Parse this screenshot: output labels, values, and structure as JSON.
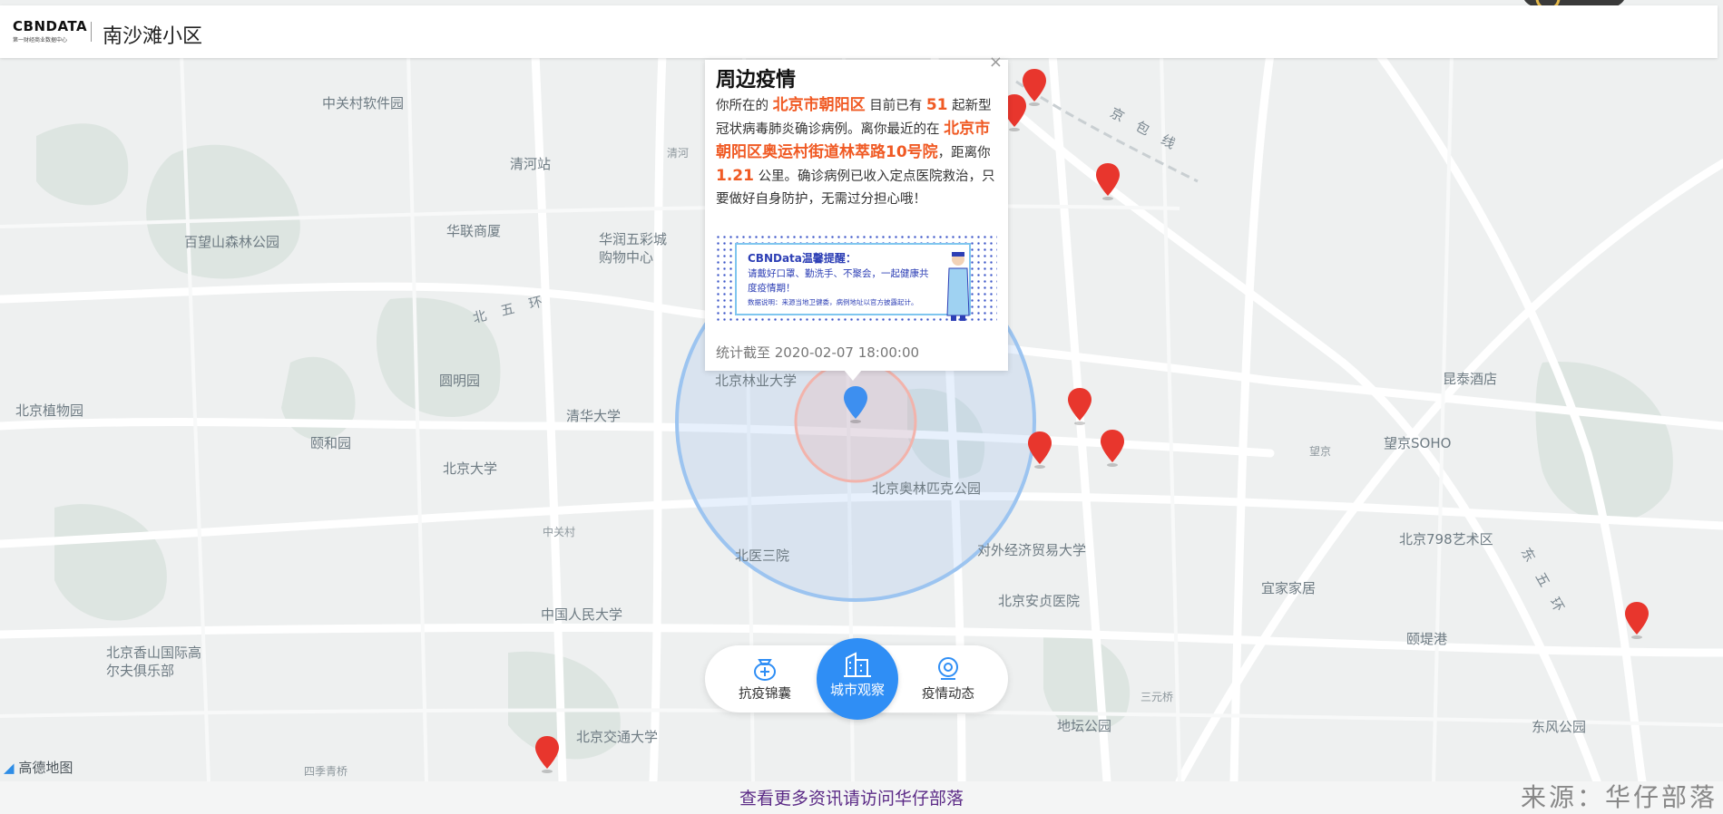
{
  "header": {
    "logo_text": "CBNDATA",
    "logo_sub": "第一财经商业数据中心",
    "title": "南沙滩小区"
  },
  "map": {
    "labels": [
      "中关村软件园",
      "清河站",
      "清河",
      "华联商厦",
      "华润五彩城购物中心",
      "百望山森林公园",
      "北京林业大学",
      "清华大学",
      "圆明园",
      "颐和园",
      "北京植物园",
      "北京大学",
      "北京奥林匹克公园",
      "对外经济贸易大学",
      "北医三院",
      "中关村",
      "中国人民大学",
      "北京安贞医院",
      "北京香山国际高尔夫俱乐部",
      "北京交通大学",
      "四季青桥",
      "地坛公园",
      "三元桥",
      "北京798艺术区",
      "宜家家居",
      "颐堤港",
      "东风公园",
      "望京SOHO",
      "望京",
      "昆泰酒店",
      "北 五 环",
      "京 包 线",
      "东 五 环"
    ],
    "attribution": "高德地图"
  },
  "popup": {
    "title": "周边疫情",
    "text_1": "你所在的",
    "district": "北京市朝阳区",
    "text_2": "目前已有",
    "count": "51",
    "text_3": "起新型冠状病毒肺炎确诊病例。离你最近的在",
    "nearest_place": "北京市朝阳区奥运村街道林萃路10号院",
    "text_4": "，距离你",
    "distance": "1.21",
    "text_5": "公里。确诊病例已收入定点医院救治，只要做好自身防护，无需过分担心哦！",
    "close": "×",
    "banner": {
      "heading": "CBNData温馨提醒：",
      "message": "请戴好口罩、勤洗手、不聚会，一起健康共度疫情期！",
      "note": "数据说明：来源当地卫健委，病例地址以官方披露起计。"
    },
    "timestamp": "统计截至 2020-02-07 18:00:00"
  },
  "nav": {
    "left": "抗疫锦囊",
    "center": "城市观察",
    "right": "疫情动态"
  },
  "footer": {
    "link": "查看更多资讯请访问华仔部落",
    "source": "来源：华仔部落"
  },
  "colors": {
    "highlight": "#f05a24",
    "accent_blue": "#2f8ef5",
    "pin_red": "#e8362d",
    "link_purple": "#5b2a86"
  }
}
